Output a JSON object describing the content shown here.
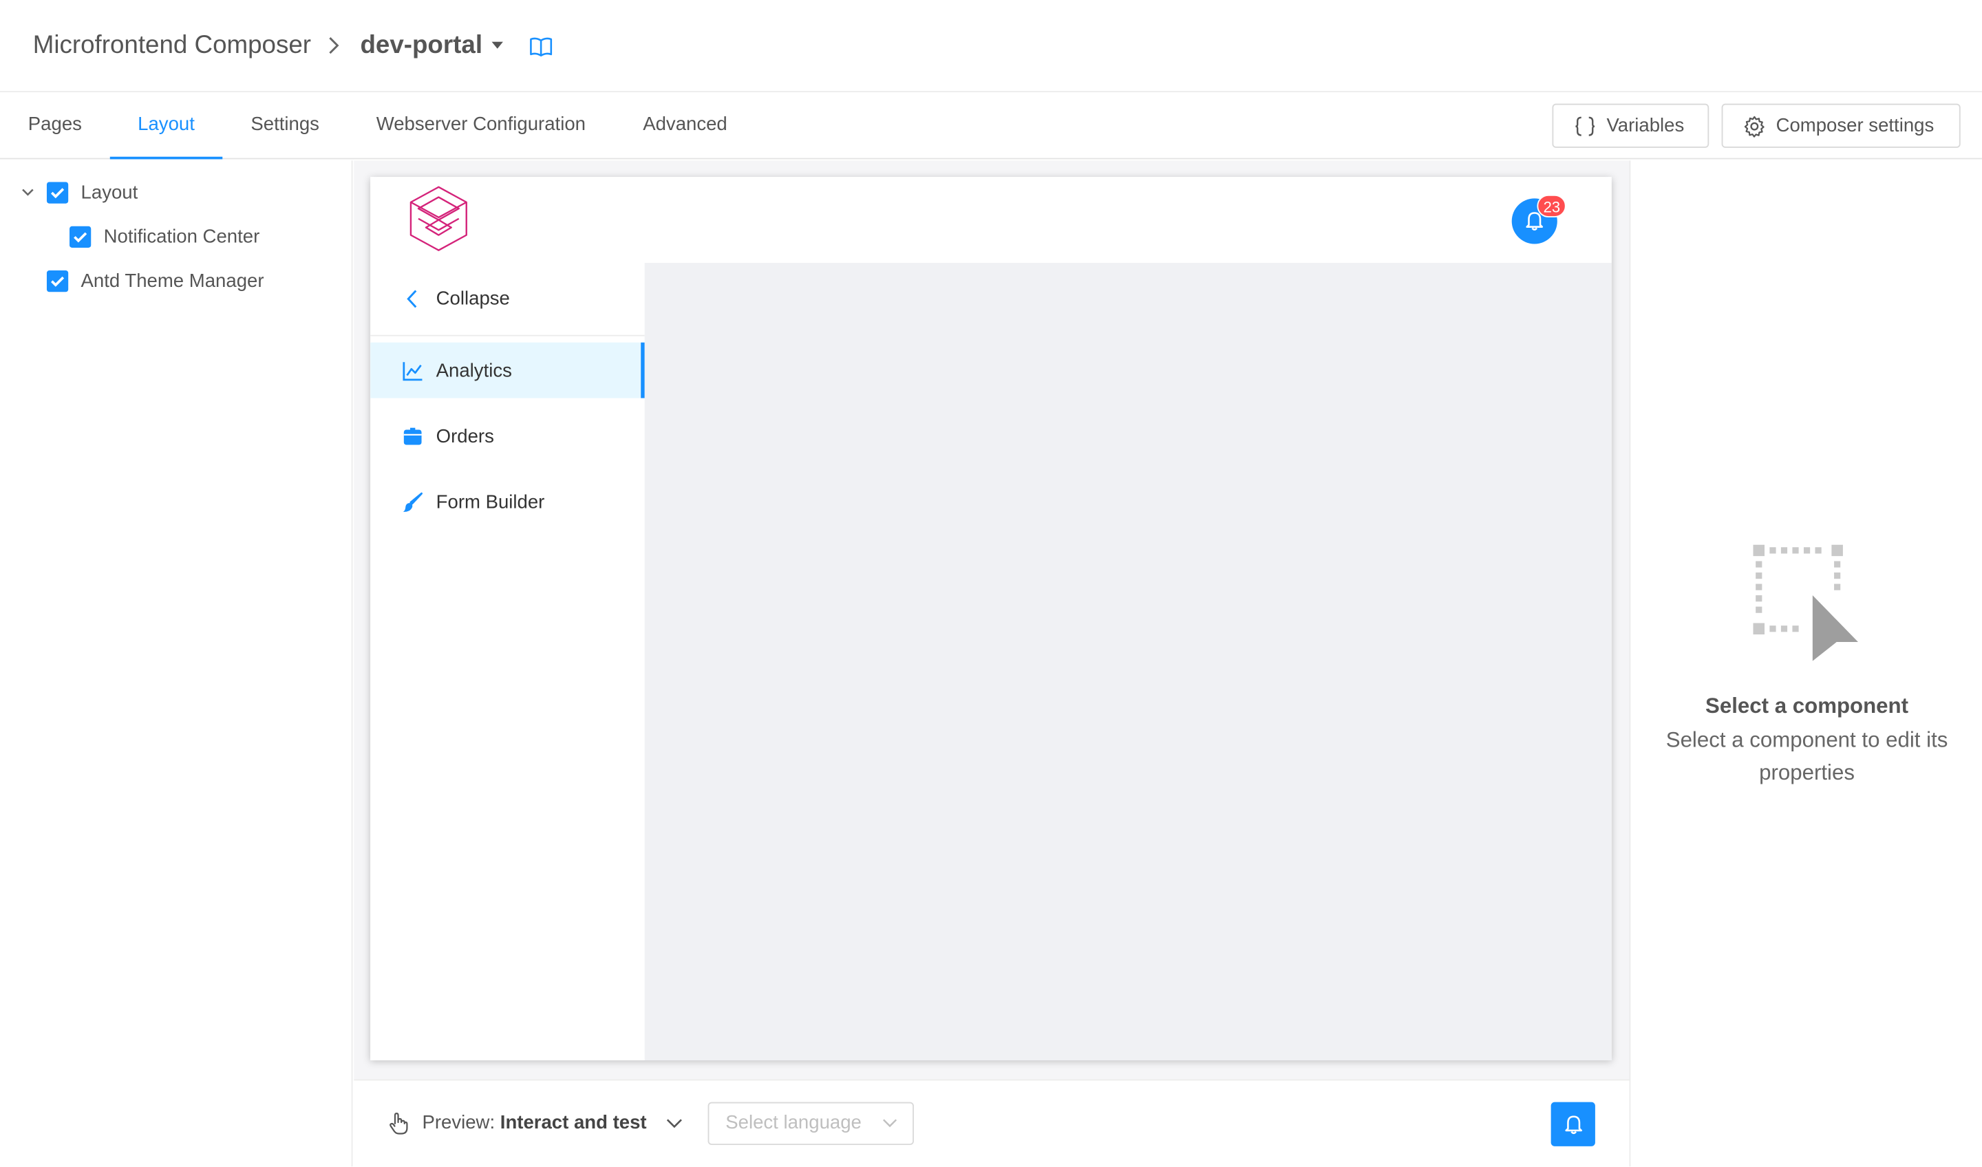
{
  "header": {
    "app_title": "Microfrontend Composer",
    "project_name": "dev-portal"
  },
  "tabs": [
    {
      "label": "Pages",
      "active": false
    },
    {
      "label": "Layout",
      "active": true
    },
    {
      "label": "Settings",
      "active": false
    },
    {
      "label": "Webserver Configuration",
      "active": false
    },
    {
      "label": "Advanced",
      "active": false
    }
  ],
  "toolbar": {
    "variables_label": "Variables",
    "composer_settings_label": "Composer settings"
  },
  "tree": {
    "items": [
      {
        "label": "Layout",
        "checked": true,
        "level": 0,
        "expanded": true
      },
      {
        "label": "Notification Center",
        "checked": true,
        "level": 1
      },
      {
        "label": "Antd Theme Manager",
        "checked": true,
        "level": 0
      }
    ]
  },
  "preview_app": {
    "notification_count": "23",
    "collapse_label": "Collapse",
    "menu": [
      {
        "label": "Analytics",
        "icon": "line-chart-icon",
        "selected": true
      },
      {
        "label": "Orders",
        "icon": "box-icon",
        "selected": false
      },
      {
        "label": "Form Builder",
        "icon": "brush-icon",
        "selected": false
      }
    ]
  },
  "bottom_bar": {
    "preview_prefix": "Preview:",
    "preview_mode": "Interact and test",
    "language_placeholder": "Select language"
  },
  "right_panel": {
    "title": "Select a component",
    "description": "Select a component to edit its properties"
  },
  "colors": {
    "accent": "#1890ff",
    "badge": "#ff4d4f",
    "logo": "#d4237a",
    "selected_bg": "#e6f7ff"
  }
}
